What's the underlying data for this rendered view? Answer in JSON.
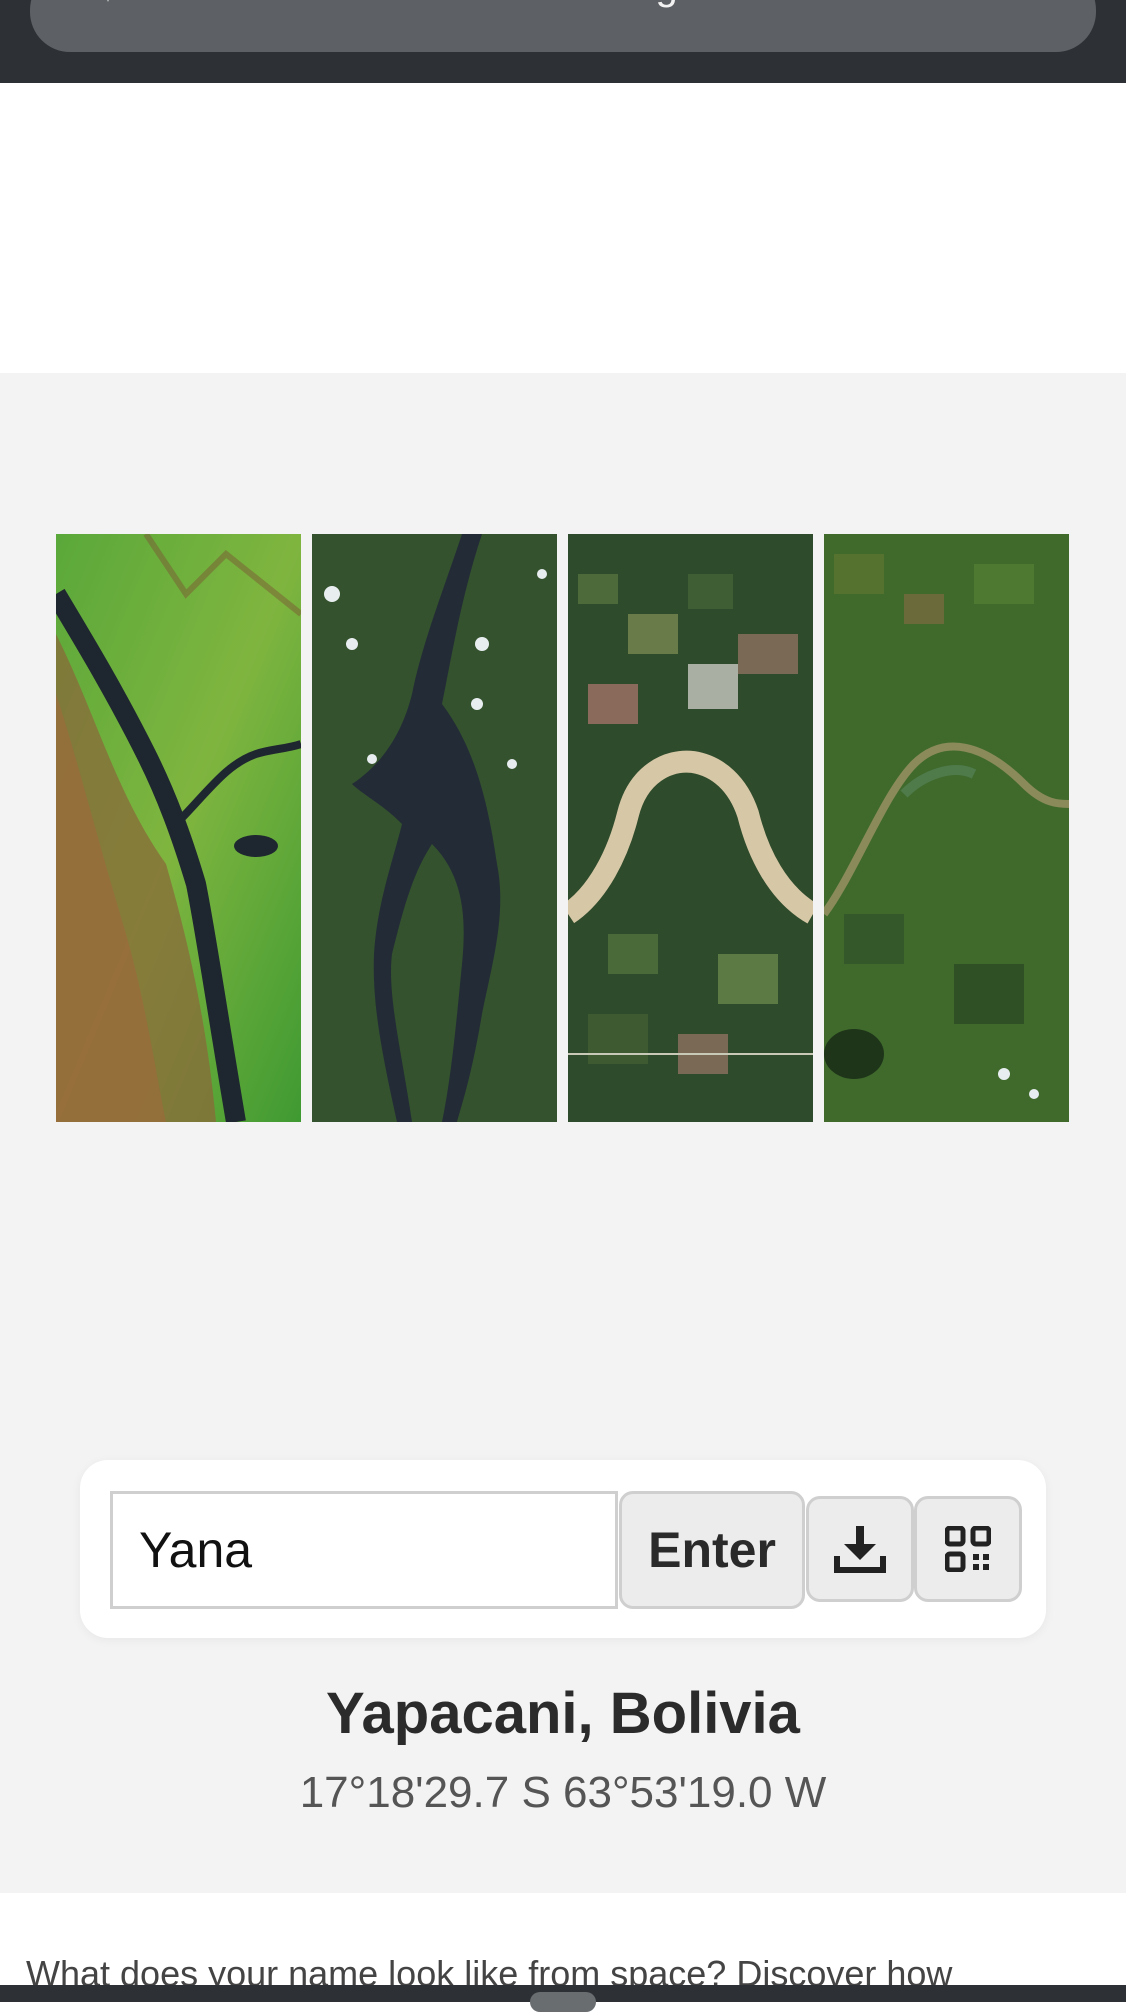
{
  "browser": {
    "url": "science.nasa.gov"
  },
  "gallery": {
    "strips": [
      {
        "name": "letter-strip-1"
      },
      {
        "name": "letter-strip-2"
      },
      {
        "name": "letter-strip-3"
      },
      {
        "name": "letter-strip-4"
      }
    ]
  },
  "form": {
    "name_value": "Yana",
    "enter_label": "Enter",
    "download_icon": "download-icon",
    "qr_icon": "qr-code-icon"
  },
  "result": {
    "place": "Yapacani, Bolivia",
    "coordinates": "17°18'29.7 S 63°53'19.0 W"
  },
  "intro": {
    "teaser": "What does your name look like from space? Discover how"
  }
}
